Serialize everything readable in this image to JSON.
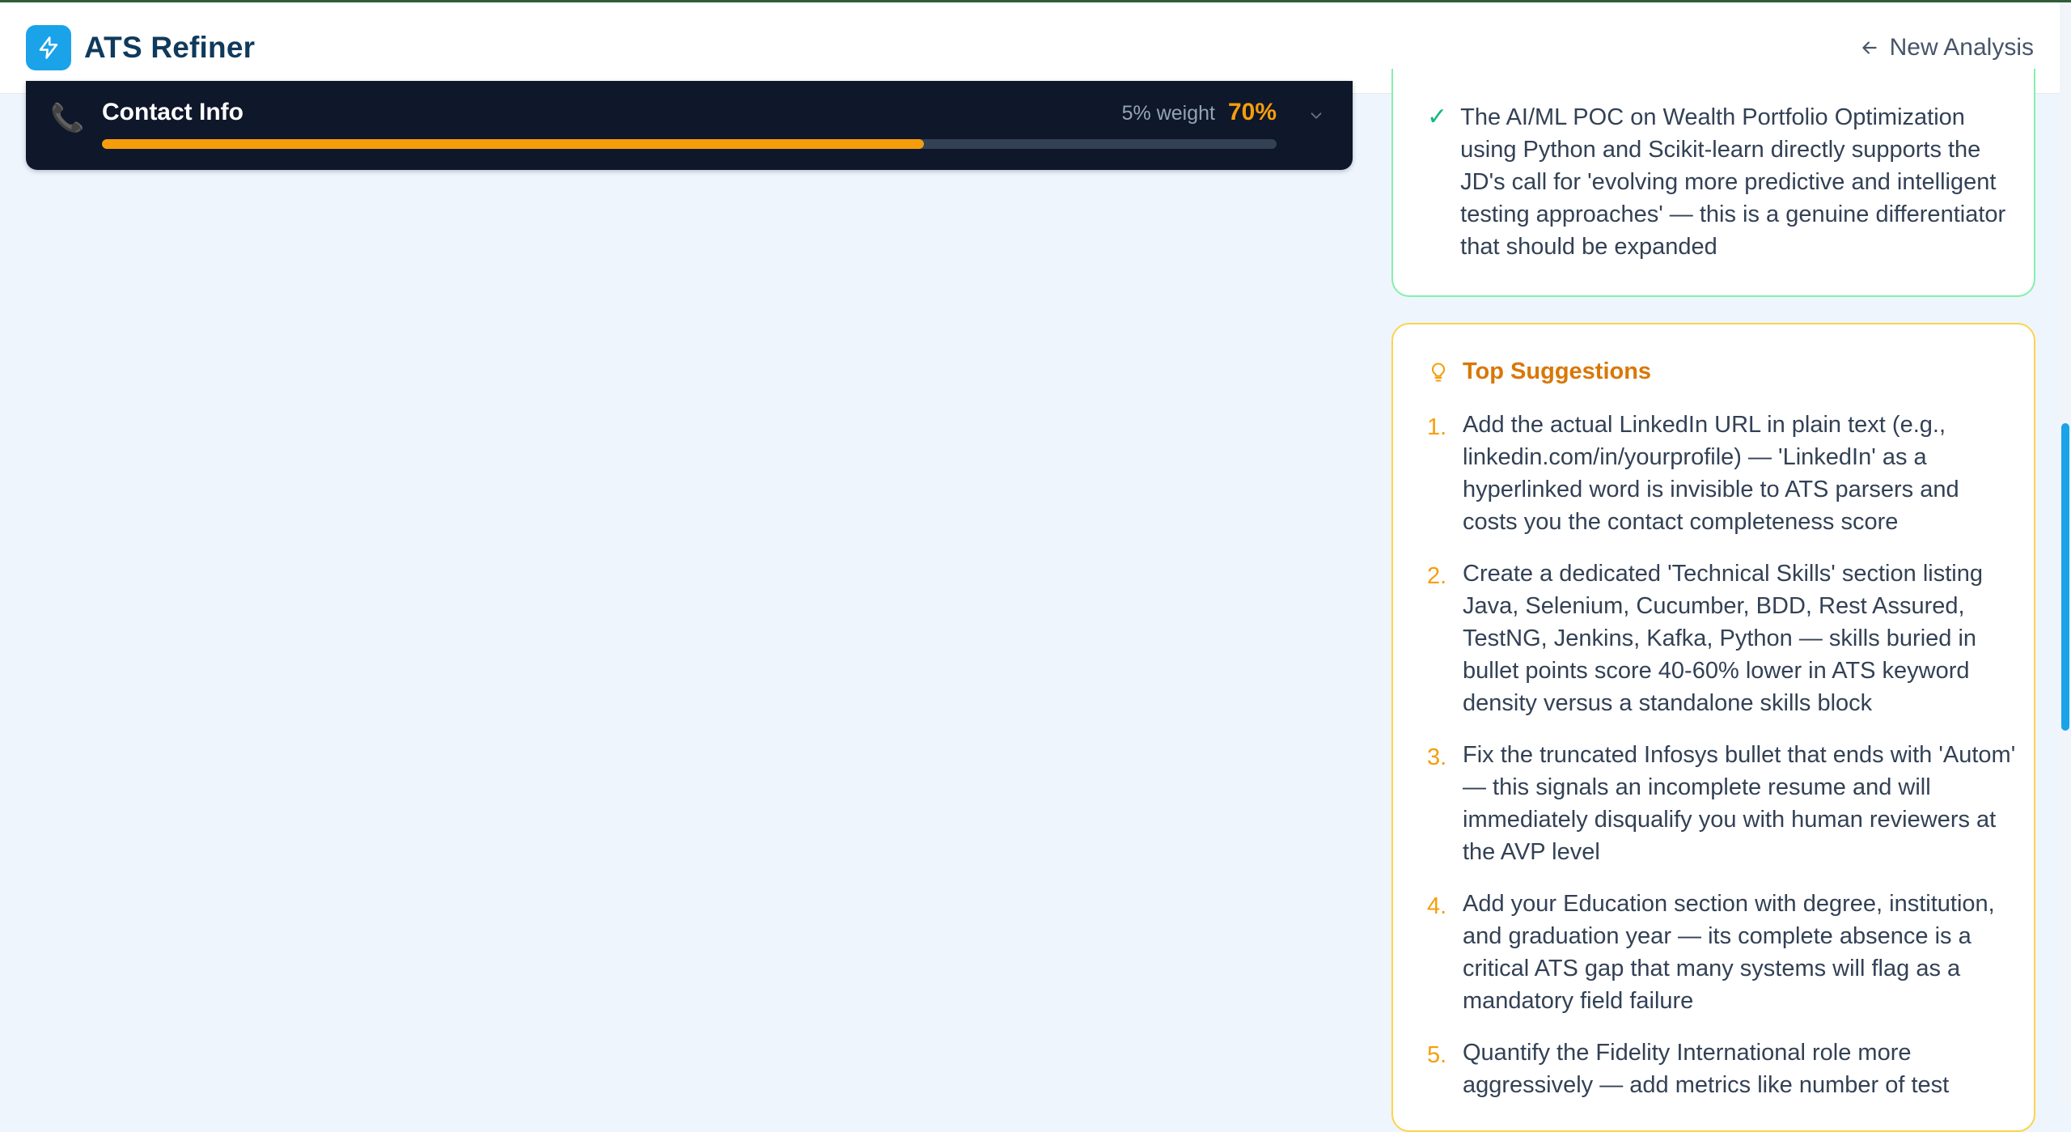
{
  "app": {
    "title": "ATS Refiner",
    "new_analysis_label": "New Analysis"
  },
  "contact_section": {
    "title": "Contact Info",
    "weight_label": "5% weight",
    "score_label": "70%",
    "score_fraction": 0.7,
    "icon": "phone-icon"
  },
  "strength": {
    "text": "The AI/ML POC on Wealth Portfolio Optimization using Python and Scikit-learn directly supports the JD's call for 'evolving more predictive and intelligent testing approaches' — this is a genuine differentiator that should be expanded"
  },
  "suggestions": {
    "title": "Top Suggestions",
    "items": [
      {
        "num": "1.",
        "text": "Add the actual LinkedIn URL in plain text (e.g., linkedin.com/in/yourprofile) — 'LinkedIn' as a hyperlinked word is invisible to ATS parsers and costs you the contact completeness score"
      },
      {
        "num": "2.",
        "text": "Create a dedicated 'Technical Skills' section listing Java, Selenium, Cucumber, BDD, Rest Assured, TestNG, Jenkins, Kafka, Python — skills buried in bullet points score 40-60% lower in ATS keyword density versus a standalone skills block"
      },
      {
        "num": "3.",
        "text": "Fix the truncated Infosys bullet that ends with 'Autom' — this signals an incomplete resume and will immediately disqualify you with human reviewers at the AVP level"
      },
      {
        "num": "4.",
        "text": "Add your Education section with degree, institution, and graduation year — its complete absence is a critical ATS gap that many systems will flag as a mandatory field failure"
      },
      {
        "num": "5.",
        "text": "Quantify the Fidelity International role more aggressively — add metrics like number of test"
      }
    ]
  },
  "colors": {
    "accent": "#1aa3e8",
    "brand_text": "#0f3a5c",
    "warning": "#f59e0b",
    "success": "#10b981",
    "dark_card": "#0f172a"
  }
}
